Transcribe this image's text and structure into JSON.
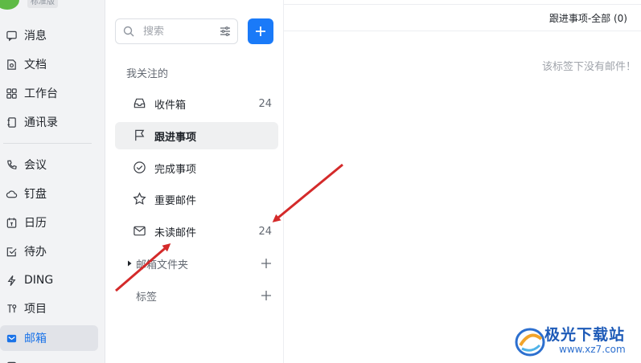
{
  "app": {
    "edition_badge": "标准版",
    "brand_color": "#5fba46",
    "accent_color": "#1a7af8"
  },
  "nav": {
    "items": [
      {
        "label": "消息",
        "icon": "message-icon"
      },
      {
        "label": "文档",
        "icon": "document-icon"
      },
      {
        "label": "工作台",
        "icon": "workbench-icon"
      },
      {
        "label": "通讯录",
        "icon": "contacts-icon"
      },
      {
        "label": "会议",
        "icon": "meeting-phone-icon"
      },
      {
        "label": "钉盘",
        "icon": "cloud-drive-icon"
      },
      {
        "label": "日历",
        "icon": "calendar-icon"
      },
      {
        "label": "待办",
        "icon": "todo-check-icon"
      },
      {
        "label": "DING",
        "icon": "ding-lightning-icon"
      },
      {
        "label": "项目",
        "icon": "project-icon"
      },
      {
        "label": "邮箱",
        "icon": "mail-icon",
        "active": true
      }
    ]
  },
  "folders": {
    "search_placeholder": "搜索",
    "section_favorites": "我关注的",
    "items": [
      {
        "label": "收件箱",
        "count": "24",
        "icon": "inbox-icon"
      },
      {
        "label": "跟进事项",
        "count": "",
        "icon": "flag-icon",
        "active": true
      },
      {
        "label": "完成事项",
        "count": "",
        "icon": "check-circle-icon"
      },
      {
        "label": "重要邮件",
        "count": "",
        "icon": "star-icon"
      },
      {
        "label": "未读邮件",
        "count": "24",
        "icon": "envelope-icon"
      }
    ],
    "group_mail_folders": "邮箱文件夹",
    "group_tags": "标签"
  },
  "main": {
    "header_title": "跟进事项-全部 (0)",
    "empty_message": "该标签下没有邮件！"
  },
  "watermark": {
    "title": "极光下载站",
    "url": "www.xz7.com"
  }
}
